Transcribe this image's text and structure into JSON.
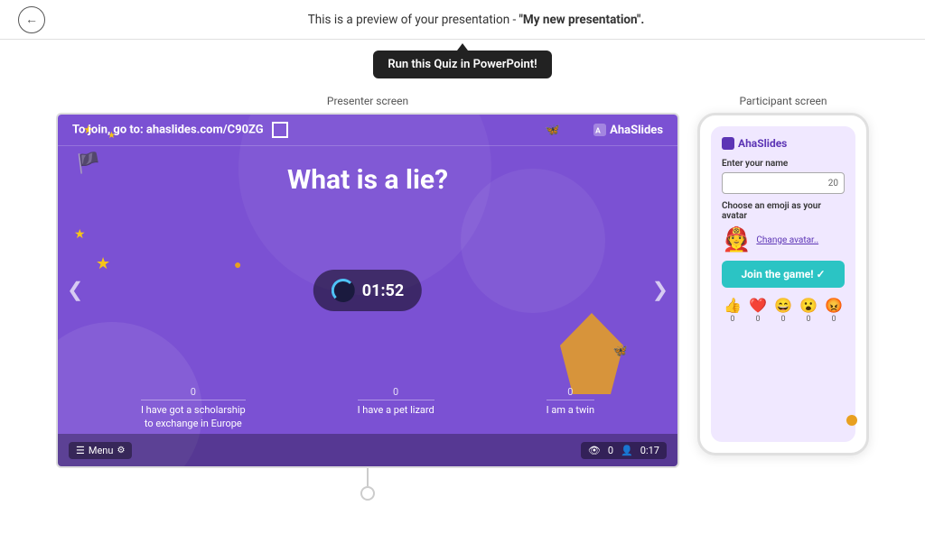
{
  "header": {
    "preview_text": "This is a preview of your presentation - ",
    "presentation_name": "\"My new presentation\".",
    "back_label": "←"
  },
  "cta": {
    "button_label": "Run this Quiz in PowerPoint!"
  },
  "presenter": {
    "screen_label": "Presenter screen",
    "join_text": "To join, go to: ahaslides.com/C90ZG",
    "brand": "AhaSlides",
    "quiz_title": "What is a lie?",
    "timer": "01:52",
    "nav_left": "❮",
    "nav_right": "❯",
    "answers": [
      {
        "count": "0",
        "label": "I have got a scholarship\nto exchange in Europe"
      },
      {
        "count": "0",
        "label": "I have a pet lizard"
      },
      {
        "count": "0",
        "label": "I am a twin"
      }
    ],
    "menu_label": "Menu",
    "stats_participants": "0",
    "stats_time": "0:17"
  },
  "participant": {
    "screen_label": "Participant screen",
    "brand": "AhaSlides",
    "enter_name_label": "Enter your name",
    "name_input_placeholder": "",
    "char_count": "20",
    "choose_avatar_label": "Choose an emoji as your avatar",
    "change_avatar_label": "Change avatar..",
    "join_button": "Join the game! ✓",
    "reactions": [
      {
        "emoji": "👍",
        "count": "0"
      },
      {
        "emoji": "❤️",
        "count": "0"
      },
      {
        "emoji": "😄",
        "count": "0"
      },
      {
        "emoji": "😮",
        "count": "0"
      },
      {
        "emoji": "😡",
        "count": "0"
      }
    ]
  }
}
